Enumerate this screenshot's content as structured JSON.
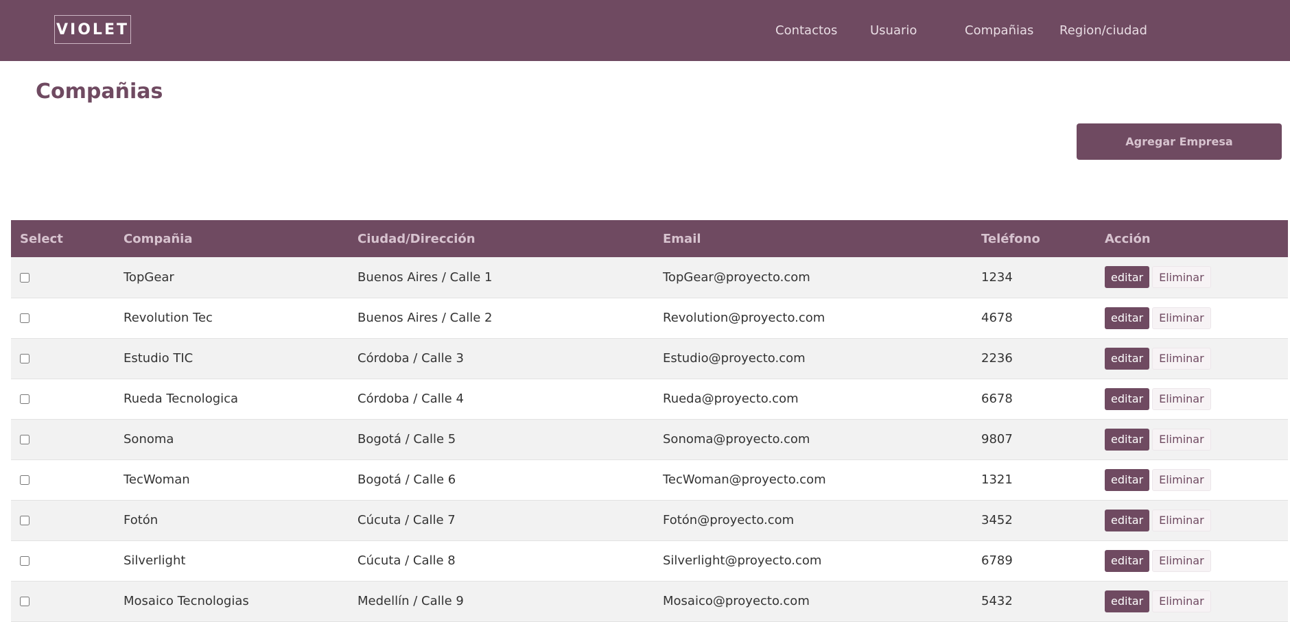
{
  "nav": {
    "logo": "VIOLET",
    "links": [
      "Contactos",
      "Usuario",
      "Compañias",
      "Region/ciudad"
    ]
  },
  "page": {
    "title": "Compañias",
    "add_button": "Agregar Empresa"
  },
  "table": {
    "headers": [
      "Select",
      "Compañia",
      "Ciudad/Dirección",
      "Email",
      "Teléfono",
      "Acción"
    ],
    "edit_label": "editar",
    "delete_label": "Eliminar",
    "rows": [
      {
        "company": "TopGear",
        "city": "Buenos Aires / Calle 1",
        "email": "TopGear@proyecto.com",
        "phone": "1234"
      },
      {
        "company": "Revolution Tec",
        "city": "Buenos Aires / Calle 2",
        "email": "Revolution@proyecto.com",
        "phone": "4678"
      },
      {
        "company": "Estudio TIC",
        "city": "Córdoba / Calle 3",
        "email": "Estudio@proyecto.com",
        "phone": "2236"
      },
      {
        "company": "Rueda Tecnologica",
        "city": "Córdoba / Calle 4",
        "email": "Rueda@proyecto.com",
        "phone": "6678"
      },
      {
        "company": "Sonoma",
        "city": "Bogotá / Calle 5",
        "email": "Sonoma@proyecto.com",
        "phone": "9807"
      },
      {
        "company": "TecWoman",
        "city": "Bogotá / Calle 6",
        "email": "TecWoman@proyecto.com",
        "phone": "1321"
      },
      {
        "company": "Fotón",
        "city": "Cúcuta / Calle 7",
        "email": "Fotón@proyecto.com",
        "phone": "3452"
      },
      {
        "company": "Silverlight",
        "city": "Cúcuta / Calle 8",
        "email": "Silverlight@proyecto.com",
        "phone": "6789"
      },
      {
        "company": "Mosaico Tecnologias",
        "city": "Medellín / Calle 9",
        "email": "Mosaico@proyecto.com",
        "phone": "5432"
      }
    ]
  },
  "colors": {
    "brand": "#6f4a61",
    "row_alt": "#f2f2f2"
  }
}
